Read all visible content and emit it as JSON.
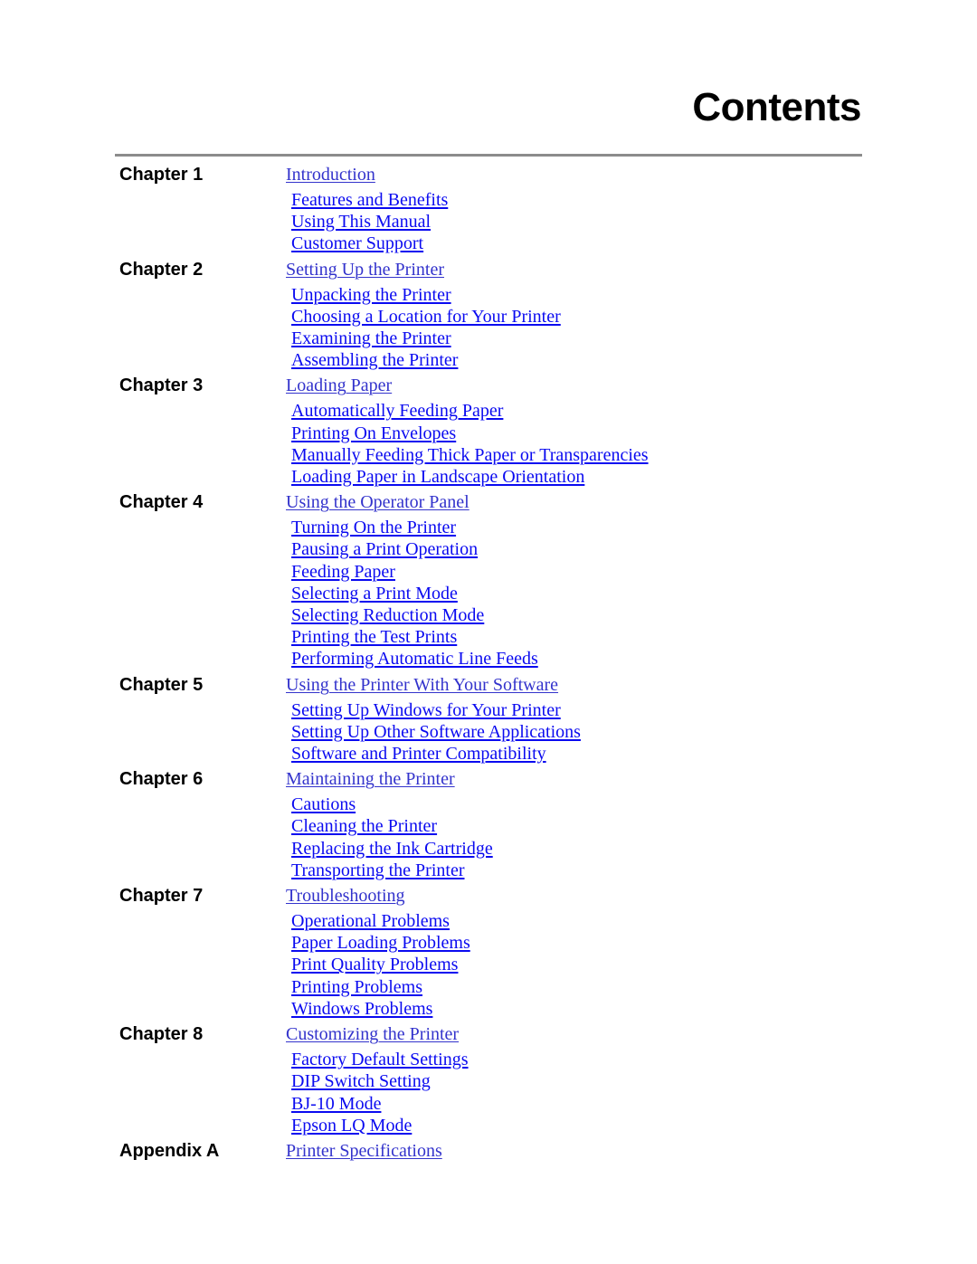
{
  "page": {
    "title": "Contents"
  },
  "colors": {
    "chapter_link": "#3333cc",
    "section_link": "#0a0af0",
    "rule": "#8c8c8c",
    "text": "#000000"
  },
  "toc": [
    {
      "label": "Chapter 1",
      "title": "Introduction",
      "sections": [
        "Features and Benefits",
        "Using This Manual",
        "Customer Support"
      ]
    },
    {
      "label": "Chapter 2",
      "title": "Setting Up the Printer",
      "sections": [
        "Unpacking the Printer",
        "Choosing a Location for Your Printer",
        "Examining the Printer",
        "Assembling the Printer"
      ]
    },
    {
      "label": "Chapter 3",
      "title": "Loading Paper",
      "sections": [
        "Automatically Feeding Paper",
        "Printing On Envelopes",
        "Manually Feeding Thick Paper or Transparencies",
        "Loading Paper in Landscape Orientation"
      ]
    },
    {
      "label": "Chapter 4",
      "title": "Using the Operator Panel",
      "sections": [
        "Turning On the Printer",
        "Pausing a Print Operation",
        "Feeding Paper",
        "Selecting a Print Mode",
        "Selecting Reduction Mode",
        "Printing the Test Prints",
        "Performing Automatic Line Feeds"
      ]
    },
    {
      "label": "Chapter 5",
      "title": "Using the Printer With Your Software",
      "sections": [
        "Setting Up Windows for Your Printer",
        "Setting Up Other Software Applications",
        "Software and Printer Compatibility"
      ]
    },
    {
      "label": "Chapter 6",
      "title": "Maintaining the Printer",
      "sections": [
        "Cautions",
        "Cleaning the Printer",
        "Replacing the Ink Cartridge",
        "Transporting the Printer"
      ]
    },
    {
      "label": "Chapter 7",
      "title": "Troubleshooting",
      "sections": [
        "Operational Problems",
        "Paper Loading Problems",
        "Print Quality Problems",
        "Printing Problems",
        "Windows Problems"
      ]
    },
    {
      "label": "Chapter 8",
      "title": "Customizing the Printer",
      "sections": [
        "Factory Default Settings",
        "DIP Switch Setting",
        "BJ-10 Mode",
        "Epson LQ Mode"
      ]
    },
    {
      "label": "Appendix A",
      "title": "Printer Specifications",
      "sections": []
    }
  ]
}
